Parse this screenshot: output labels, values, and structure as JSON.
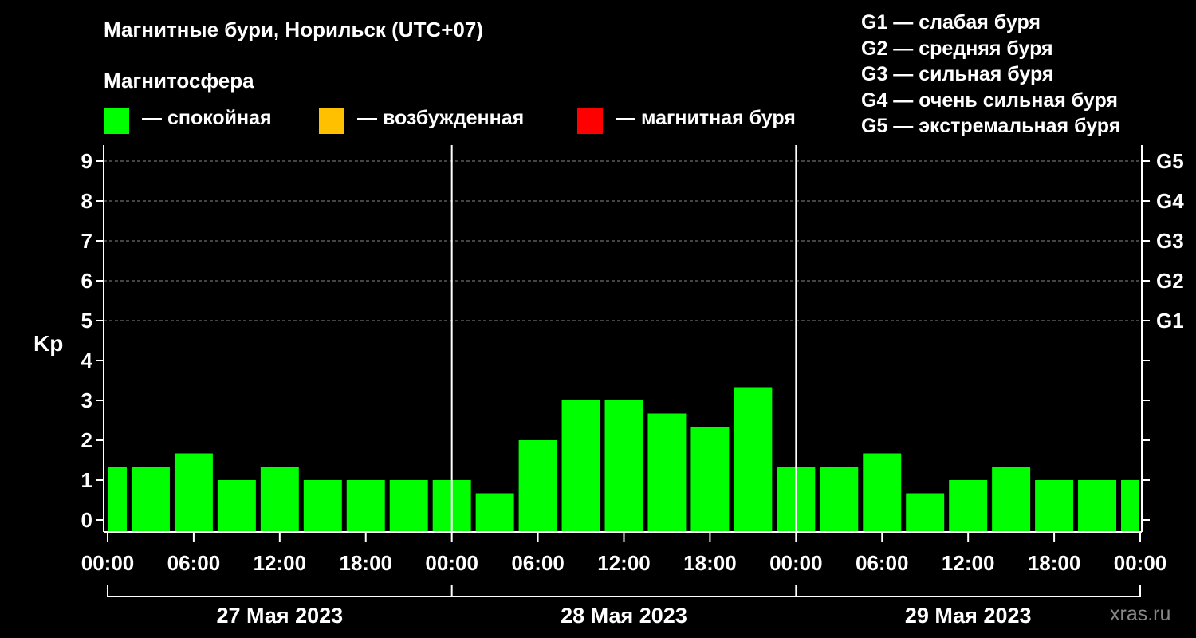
{
  "title": "Магнитные бури, Норильск (UTC+07)",
  "legend": {
    "title": "Магнитосфера",
    "items": [
      {
        "color": "#00ff00",
        "label": "— спокойная"
      },
      {
        "color": "#ffc000",
        "label": "— возбужденная"
      },
      {
        "color": "#ff0000",
        "label": "— магнитная буря"
      }
    ]
  },
  "g_scale": [
    "G1 — слабая буря",
    "G2 — средняя буря",
    "G3 — сильная буря",
    "G4 — очень сильная буря",
    "G5 — экстремальная буря"
  ],
  "watermark": "xras.ru",
  "chart_data": {
    "type": "bar",
    "ylabel": "Kp",
    "ylim": [
      -0.3,
      9.4
    ],
    "yticks": [
      0,
      1,
      2,
      3,
      4,
      5,
      6,
      7,
      8,
      9
    ],
    "right_ticks": [
      {
        "value": 5,
        "label": "G1"
      },
      {
        "value": 6,
        "label": "G2"
      },
      {
        "value": 7,
        "label": "G3"
      },
      {
        "value": 8,
        "label": "G4"
      },
      {
        "value": 9,
        "label": "G5"
      }
    ],
    "grid": true,
    "x_hours_range": [
      0,
      72
    ],
    "x_tick_labels": [
      "00:00",
      "06:00",
      "12:00",
      "18:00",
      "00:00",
      "06:00",
      "12:00",
      "18:00",
      "00:00",
      "06:00",
      "12:00",
      "18:00",
      "00:00"
    ],
    "days": [
      "27 Мая 2023",
      "28 Мая 2023",
      "29 Мая 2023"
    ],
    "bar_color": "#00ff00",
    "values": [
      1.33,
      1.33,
      1.67,
      1.0,
      1.33,
      1.0,
      1.0,
      1.0,
      1.0,
      0.67,
      2.0,
      3.0,
      3.0,
      2.67,
      2.33,
      3.33,
      1.33,
      1.33,
      1.67,
      0.67,
      1.0,
      1.33,
      1.0,
      1.0,
      1.0
    ]
  }
}
